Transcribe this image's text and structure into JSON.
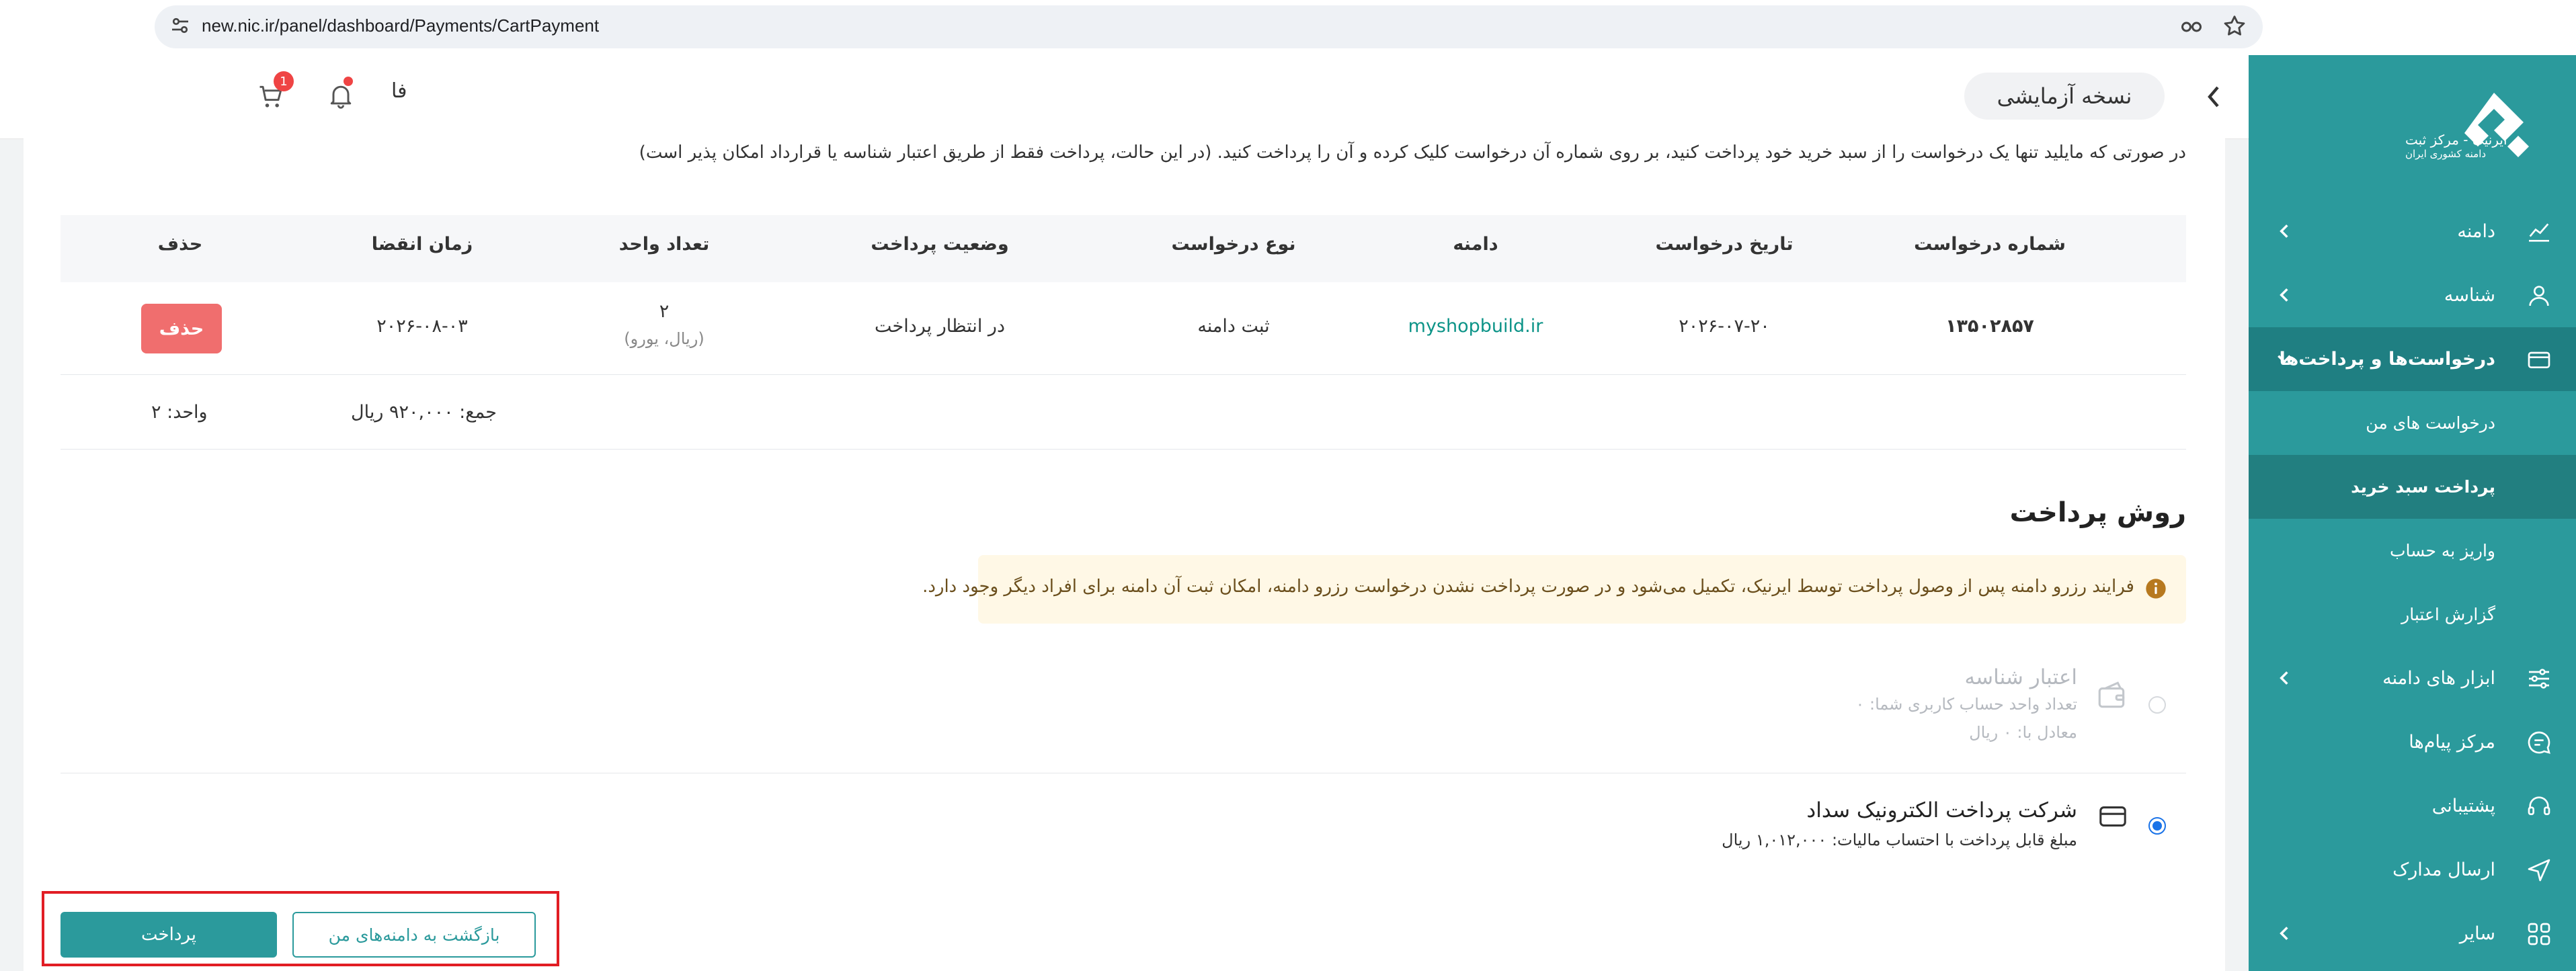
{
  "browser": {
    "url": "new.nic.ir/panel/dashboard/Payments/CartPayment"
  },
  "header": {
    "env_badge": "نسخه آزمایشی",
    "language": "فا",
    "cart_count": "1"
  },
  "sidebar": {
    "logo_title": "ایرنیک - مرکز ثبت",
    "logo_subtitle": "دامنه کشوری ایران",
    "items": [
      {
        "label": "دامنه",
        "icon": "chart-icon",
        "has_chevron": true
      },
      {
        "label": "شناسه",
        "icon": "user-icon",
        "has_chevron": true
      },
      {
        "label": "درخواست‌ها و پرداخت‌ها",
        "icon": "card-icon",
        "has_chevron": true,
        "active": true
      },
      {
        "label": "ابزار های دامنه",
        "icon": "sliders-icon",
        "has_chevron": true
      },
      {
        "label": "مرکز پیام‌ها",
        "icon": "message-icon",
        "has_chevron": false
      },
      {
        "label": "پشتیبانی",
        "icon": "headset-icon",
        "has_chevron": false
      },
      {
        "label": "ارسال مدارک",
        "icon": "send-icon",
        "has_chevron": false
      },
      {
        "label": "سایر",
        "icon": "grid-icon",
        "has_chevron": true
      }
    ],
    "subitems": [
      {
        "label": "درخواست های من"
      },
      {
        "label": "پرداخت سبد خرید",
        "active": true
      },
      {
        "label": "واریز به حساب"
      },
      {
        "label": "گزارش اعتبار"
      }
    ]
  },
  "main": {
    "intro": "در صورتی که مایلید تنها یک درخواست را از سبد خرید خود پرداخت کنید، بر روی شماره آن درخواست کلیک کرده و آن را پرداخت کنید. (در این حالت، پرداخت فقط از طریق اعتبار شناسه یا قرارداد امکان پذیر است)",
    "table": {
      "headers": [
        "شماره درخواست",
        "تاریخ درخواست",
        "دامنه",
        "نوع درخواست",
        "وضعیت پرداخت",
        "تعداد واحد",
        "زمان انقضا",
        "حذف"
      ],
      "row": {
        "request_no": "۱۳۵۰۲۸۵۷",
        "request_date": "۲۰۲۶-۰۷-۲۰",
        "domain": "myshopbuild.ir",
        "request_type": "ثبت دامنه",
        "payment_status": "در انتظار پرداخت",
        "units": "۲",
        "units_note": "(ریال، یورو)",
        "expiry": "۲۰۲۶-۰۸-۰۳",
        "delete_label": "حذف"
      },
      "total": "جمع: ۹۲۰,۰۰۰ ریال",
      "units_total": "واحد: ۲"
    },
    "payment_section_title": "روش پرداخت",
    "notice": "فرایند رزرو دامنه پس از وصول پرداخت توسط ایرنیک، تکمیل می‌شود و در صورت پرداخت نشدن درخواست رزرو دامنه، امکان ثبت آن دامنه برای افراد دیگر وجود دارد.",
    "options": [
      {
        "title": "اعتبار شناسه",
        "line1": "تعداد واحد حساب کاربری شما: ۰",
        "line2": "معادل با: ۰ ریال",
        "disabled": true,
        "selected": false
      },
      {
        "title": "شرکت پرداخت الکترونیک سداد",
        "line1": "مبلغ قابل پرداخت با احتساب مالیات: ۱,۰۱۲,۰۰۰ ریال",
        "disabled": false,
        "selected": true
      }
    ],
    "back_button": "بازگشت به دامنه‌های من",
    "pay_button": "پرداخت"
  },
  "colors": {
    "brand_teal": "#2b9a9c",
    "sidebar_active": "#1f7f82",
    "delete_red": "#f06e6e",
    "highlight_red": "#e11d24",
    "notice_bg": "#fff8e6"
  }
}
